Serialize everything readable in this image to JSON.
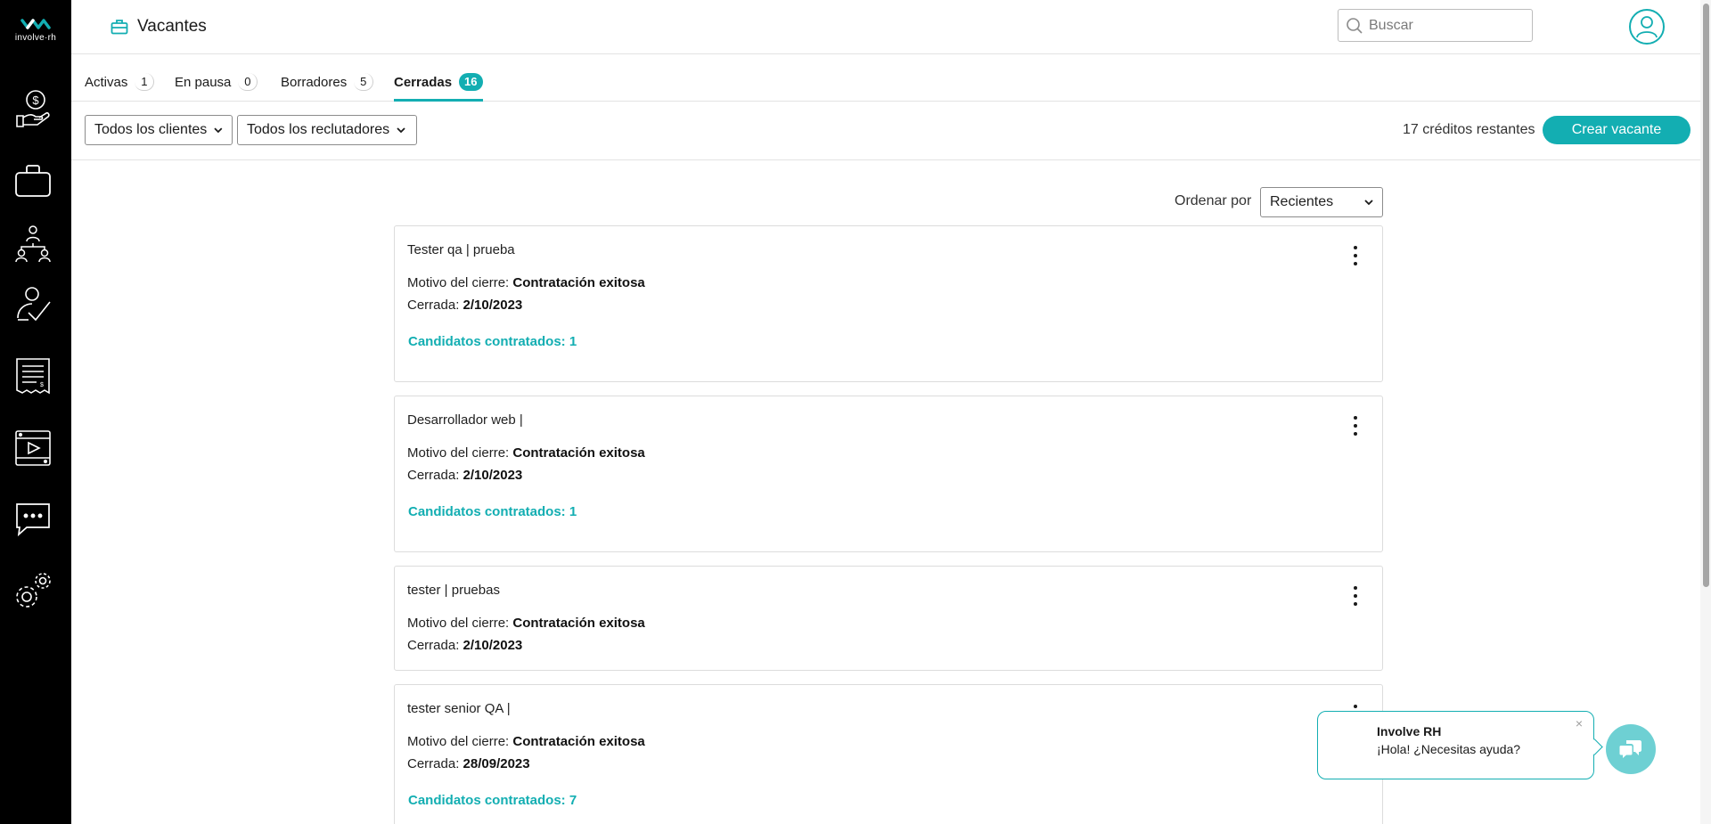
{
  "app": {
    "brand": "involve·rh",
    "accent_color": "#13aeb2"
  },
  "sidebar": {
    "items": [
      {
        "icon": "payments-hand-icon"
      },
      {
        "icon": "briefcase-icon"
      },
      {
        "icon": "candidates-org-icon"
      },
      {
        "icon": "evaluation-check-icon"
      },
      {
        "icon": "invoice-icon"
      },
      {
        "icon": "video-tutorial-icon"
      },
      {
        "icon": "chat-icon"
      },
      {
        "icon": "settings-gears-icon"
      }
    ]
  },
  "header": {
    "title": "Vacantes",
    "search_placeholder": "Buscar"
  },
  "tabs": [
    {
      "label": "Activas",
      "count": "1"
    },
    {
      "label": "En pausa",
      "count": "0"
    },
    {
      "label": "Borradores",
      "count": "5"
    },
    {
      "label": "Cerradas",
      "count": "16",
      "active": true
    }
  ],
  "toolbar": {
    "clients_filter": "Todos los clientes",
    "recruiters_filter": "Todos los reclutadores",
    "credits": "17 créditos restantes",
    "create_label": "Crear vacante"
  },
  "sort": {
    "label": "Ordenar por",
    "value": "Recientes"
  },
  "cards": [
    {
      "title": "Tester qa | prueba",
      "reason_label": "Motivo del cierre:",
      "reason": "Contratación exitosa",
      "closed_label": "Cerrada:",
      "closed_date": "2/10/2023",
      "hired": "Candidatos contratados: 1"
    },
    {
      "title": "Desarrollador web |",
      "reason_label": "Motivo del cierre:",
      "reason": "Contratación exitosa",
      "closed_label": "Cerrada:",
      "closed_date": "2/10/2023",
      "hired": "Candidatos contratados: 1"
    },
    {
      "title": "tester | pruebas",
      "reason_label": "Motivo del cierre:",
      "reason": "Contratación exitosa",
      "closed_label": "Cerrada:",
      "closed_date": "2/10/2023"
    },
    {
      "title": "tester senior QA |",
      "reason_label": "Motivo del cierre:",
      "reason": "Contratación exitosa",
      "closed_label": "Cerrada:",
      "closed_date": "28/09/2023",
      "hired": "Candidatos contratados: 7"
    }
  ],
  "chat": {
    "name": "Involve RH",
    "message": "¡Hola! ¿Necesitas ayuda?",
    "close": "×"
  }
}
